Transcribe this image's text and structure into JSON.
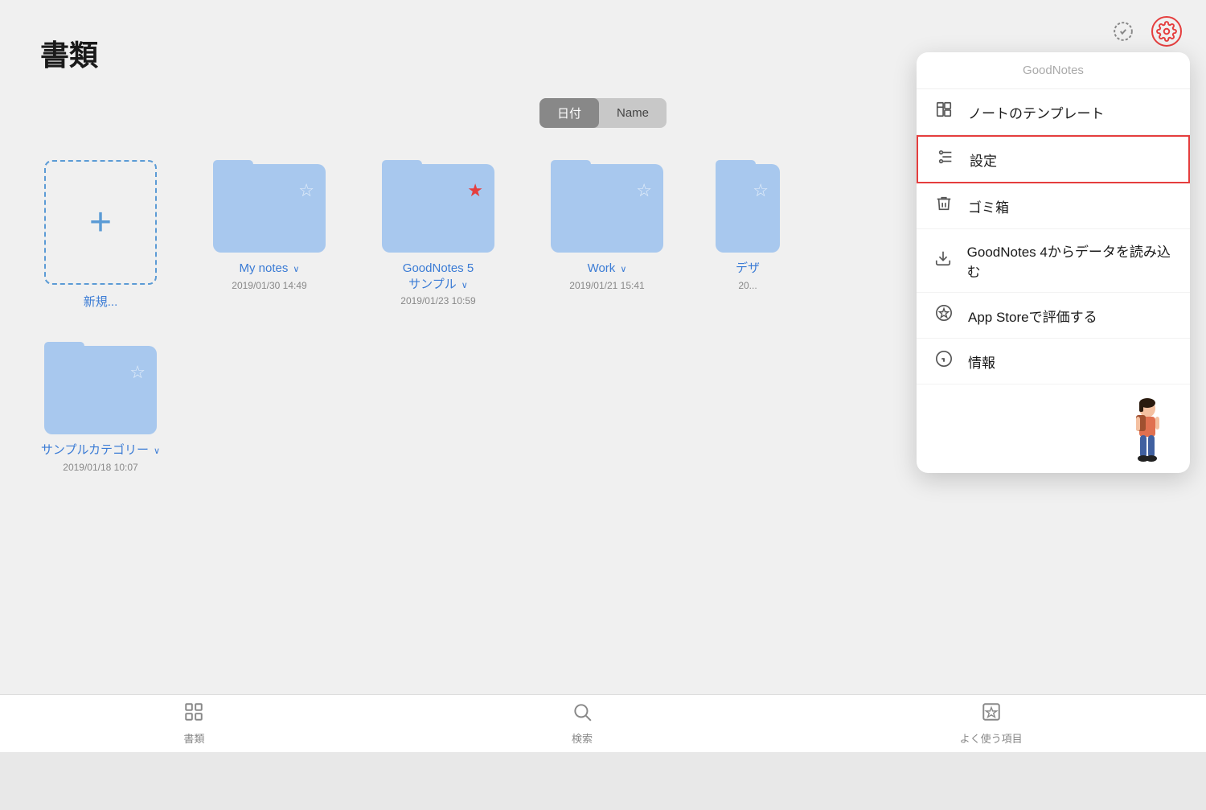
{
  "page": {
    "title": "書類",
    "background_color": "#f0f0f0"
  },
  "sort_controls": {
    "active_label": "日付",
    "inactive_label": "Name"
  },
  "folders": [
    {
      "id": "new",
      "type": "new",
      "label": "新規...",
      "date": ""
    },
    {
      "id": "my-notes",
      "type": "folder",
      "name": "My notes",
      "chevron": "∨",
      "date": "2019/01/30 14:49",
      "star": "☆",
      "star_color": "white",
      "starred": false
    },
    {
      "id": "goodnotes-sample",
      "type": "folder",
      "name": "GoodNotes 5\nサンプル",
      "chevron": "∨",
      "date": "2019/01/23 10:59",
      "star": "★",
      "star_color": "red",
      "starred": true
    },
    {
      "id": "work",
      "type": "folder",
      "name": "Work",
      "chevron": "∨",
      "date": "2019/01/21 15:41",
      "star": "☆",
      "star_color": "white",
      "starred": false
    },
    {
      "id": "desa",
      "type": "folder-partial",
      "name": "デザ",
      "date": "20...",
      "star": "☆",
      "star_color": "white",
      "starred": false
    }
  ],
  "folders_row2": [
    {
      "id": "sample-category",
      "type": "folder",
      "name": "サンプルカテゴリー",
      "chevron": "∨",
      "date": "2019/01/18 10:07",
      "star": "☆",
      "star_color": "white",
      "starred": false
    }
  ],
  "tab_bar": {
    "items": [
      {
        "id": "documents",
        "icon": "⊞",
        "label": "書類"
      },
      {
        "id": "search",
        "icon": "⌕",
        "label": "検索"
      },
      {
        "id": "favorites",
        "icon": "★",
        "label": "よく使う項目"
      }
    ]
  },
  "top_icons": {
    "check_label": "check-icon",
    "gear_label": "gear-icon"
  },
  "dropdown": {
    "header": "GoodNotes",
    "items": [
      {
        "id": "templates",
        "icon": "template",
        "label": "ノートのテンプレート"
      },
      {
        "id": "settings",
        "icon": "settings",
        "label": "設定",
        "highlighted": true
      },
      {
        "id": "trash",
        "icon": "trash",
        "label": "ゴミ箱"
      },
      {
        "id": "import",
        "icon": "import",
        "label": "GoodNotes 4からデータを読み込む"
      },
      {
        "id": "appstore",
        "icon": "star",
        "label": "App Storeで評価する"
      },
      {
        "id": "info",
        "icon": "info",
        "label": "情報"
      }
    ]
  }
}
